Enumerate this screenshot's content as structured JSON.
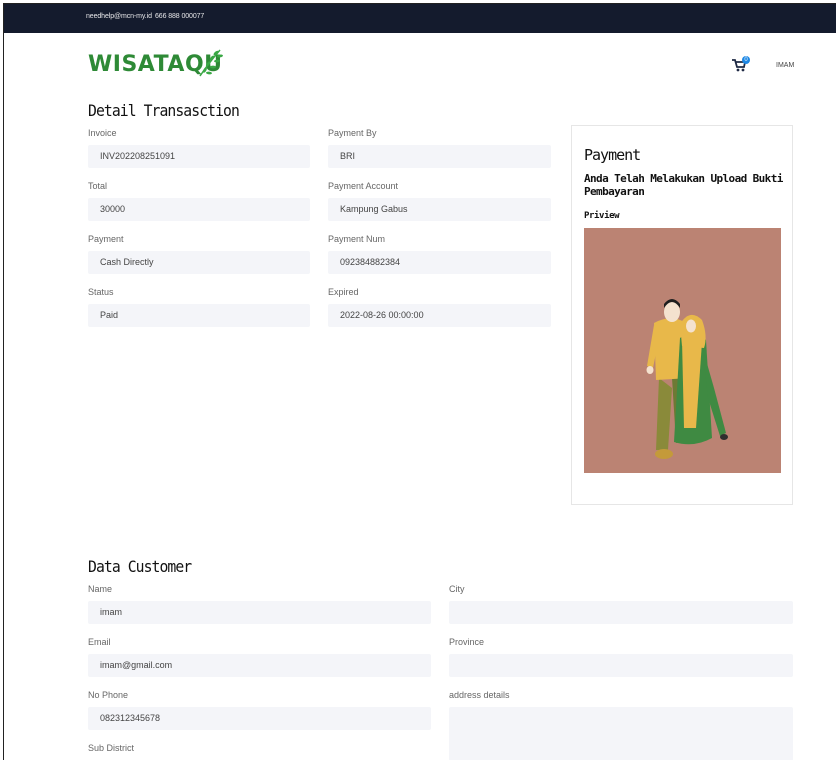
{
  "topbar": {
    "email": "needhelp@mcn-my.id",
    "phone": "666 888 000077"
  },
  "brand": {
    "name": "WISATAQU"
  },
  "header": {
    "cart_count": "0",
    "user": "IMAM"
  },
  "transaction": {
    "title": "Detail Transasction",
    "fields": [
      {
        "label": "Invoice",
        "value": "INV202208251091"
      },
      {
        "label": "Payment By",
        "value": "BRI"
      },
      {
        "label": "Total",
        "value": "30000"
      },
      {
        "label": "Payment Account",
        "value": "Kampung Gabus"
      },
      {
        "label": "Payment",
        "value": "Cash Directly"
      },
      {
        "label": "Payment Num",
        "value": "092384882384"
      },
      {
        "label": "Status",
        "value": "Paid"
      },
      {
        "label": "Expired",
        "value": "2022-08-26 00:00:00"
      }
    ]
  },
  "payment_card": {
    "title": "Payment",
    "message": "Anda Telah Melakukan Upload Bukti Pembayaran",
    "preview_label": "Priview"
  },
  "customer": {
    "title": "Data Customer",
    "fields": [
      {
        "label": "Name",
        "value": "imam"
      },
      {
        "label": "City",
        "value": ""
      },
      {
        "label": "Email",
        "value": "imam@gmail.com"
      },
      {
        "label": "Province",
        "value": ""
      },
      {
        "label": "No Phone",
        "value": "082312345678"
      },
      {
        "label": "address details",
        "value": ""
      },
      {
        "label": "Sub District",
        "value": ""
      }
    ]
  },
  "colors": {
    "topbar": "#141b2d",
    "brand_green": "#2e8a36",
    "field_bg": "#f4f5f9",
    "preview_bg": "#bb8373"
  }
}
